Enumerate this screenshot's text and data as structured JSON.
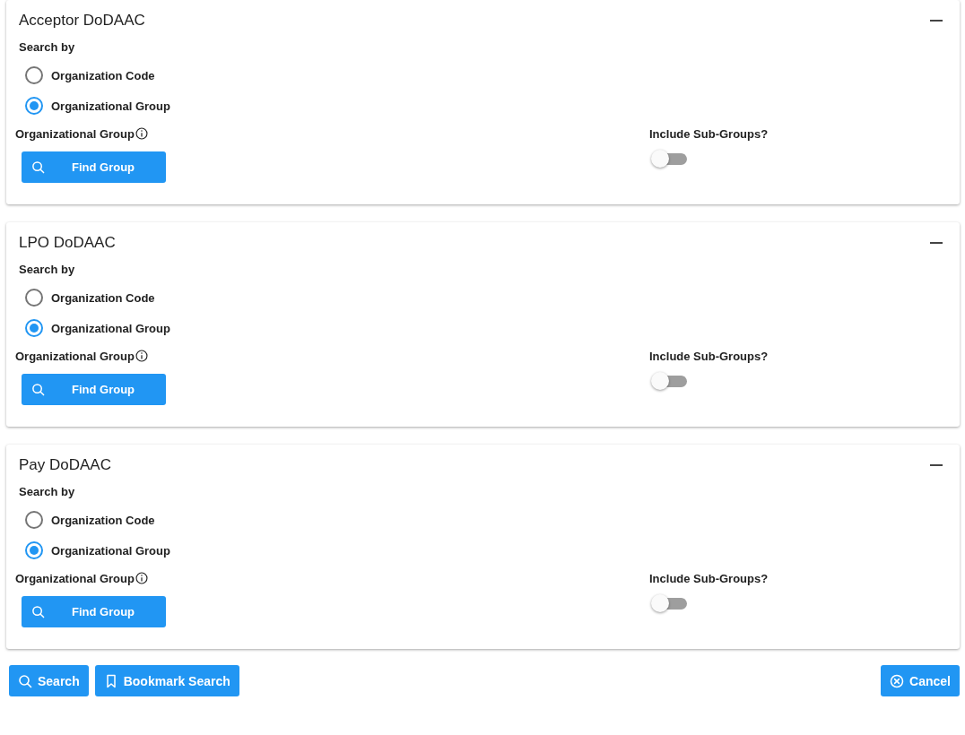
{
  "panels": [
    {
      "title": "Acceptor DoDAAC",
      "expanded": true,
      "search_by_label": "Search by",
      "options": [
        {
          "label": "Organization Code",
          "selected": false
        },
        {
          "label": "Organizational Group",
          "selected": true
        }
      ],
      "group_label": "Organizational Group",
      "find_button": "Find Group",
      "toggle": {
        "label": "Include Sub-Groups?",
        "on": false
      }
    },
    {
      "title": "LPO DoDAAC",
      "expanded": true,
      "search_by_label": "Search by",
      "options": [
        {
          "label": "Organization Code",
          "selected": false
        },
        {
          "label": "Organizational Group",
          "selected": true
        }
      ],
      "group_label": "Organizational Group",
      "find_button": "Find Group",
      "toggle": {
        "label": "Include Sub-Groups?",
        "on": false
      }
    },
    {
      "title": "Pay DoDAAC",
      "expanded": true,
      "search_by_label": "Search by",
      "options": [
        {
          "label": "Organization Code",
          "selected": false
        },
        {
          "label": "Organizational Group",
          "selected": true
        }
      ],
      "group_label": "Organizational Group",
      "find_button": "Find Group",
      "toggle": {
        "label": "Include Sub-Groups?",
        "on": false
      }
    }
  ],
  "actions": [
    {
      "label": "Search",
      "kind": "search"
    },
    {
      "label": "Bookmark Search",
      "kind": "bookmark"
    },
    {
      "label": "Cancel",
      "kind": "cancel"
    }
  ]
}
